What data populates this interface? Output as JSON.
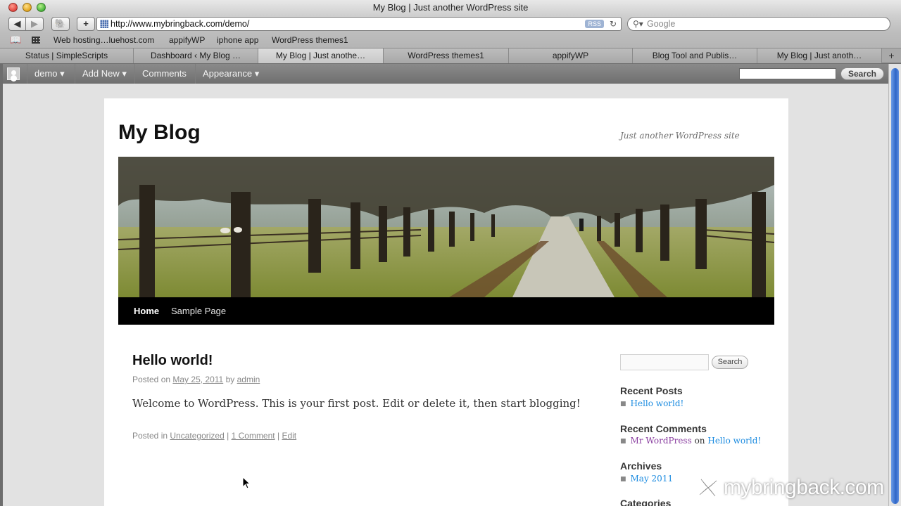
{
  "window": {
    "title": "My Blog | Just another WordPress site"
  },
  "toolbar": {
    "back_icon": "back-arrow-icon",
    "forward_icon": "forward-arrow-icon",
    "url": "http://www.mybringback.com/demo/",
    "rss_label": "RSS",
    "search_placeholder": "Google"
  },
  "bookmarks": [
    "Web hosting…luehost.com",
    "appifyWP",
    "iphone app",
    "WordPress themes1"
  ],
  "tabs": [
    {
      "label": "Status | SimpleScripts",
      "active": false
    },
    {
      "label": "Dashboard ‹ My Blog …",
      "active": false
    },
    {
      "label": "My Blog | Just anothe…",
      "active": true
    },
    {
      "label": "WordPress themes1",
      "active": false
    },
    {
      "label": "appifyWP",
      "active": false
    },
    {
      "label": "Blog Tool and Publis…",
      "active": false
    },
    {
      "label": "My Blog | Just anoth…",
      "active": false
    }
  ],
  "adminbar": {
    "user": "demo ▾",
    "add_new": "Add New ▾",
    "comments": "Comments",
    "appearance": "Appearance ▾",
    "search_button": "Search"
  },
  "site": {
    "title": "My Blog",
    "tagline": "Just another WordPress site",
    "nav": {
      "home": "Home",
      "sample": "Sample Page"
    }
  },
  "post": {
    "title": "Hello world!",
    "posted_on_label": "Posted on",
    "date": "May 25, 2011",
    "by_label": "by",
    "author": "admin",
    "content": "Welcome to WordPress. This is your first post. Edit or delete it, then start blogging!",
    "posted_in_label": "Posted in",
    "category": "Uncategorized",
    "comments_link": "1 Comment",
    "edit_link": "Edit",
    "separator": "|"
  },
  "sidebar": {
    "search_button": "Search",
    "recent_posts_title": "Recent Posts",
    "recent_posts": [
      "Hello world!"
    ],
    "recent_comments_title": "Recent Comments",
    "comment_author": "Mr WordPress",
    "comment_on": "on",
    "comment_post": "Hello world!",
    "archives_title": "Archives",
    "archives": [
      "May 2011"
    ],
    "categories_title": "Categories"
  },
  "watermark": {
    "text": "mybringback.com"
  },
  "colors": {
    "link_blue": "#1b8be0",
    "visited_purple": "#8a3fa0",
    "admin_bar": "#7a7a7a",
    "nav_black": "#000000"
  }
}
